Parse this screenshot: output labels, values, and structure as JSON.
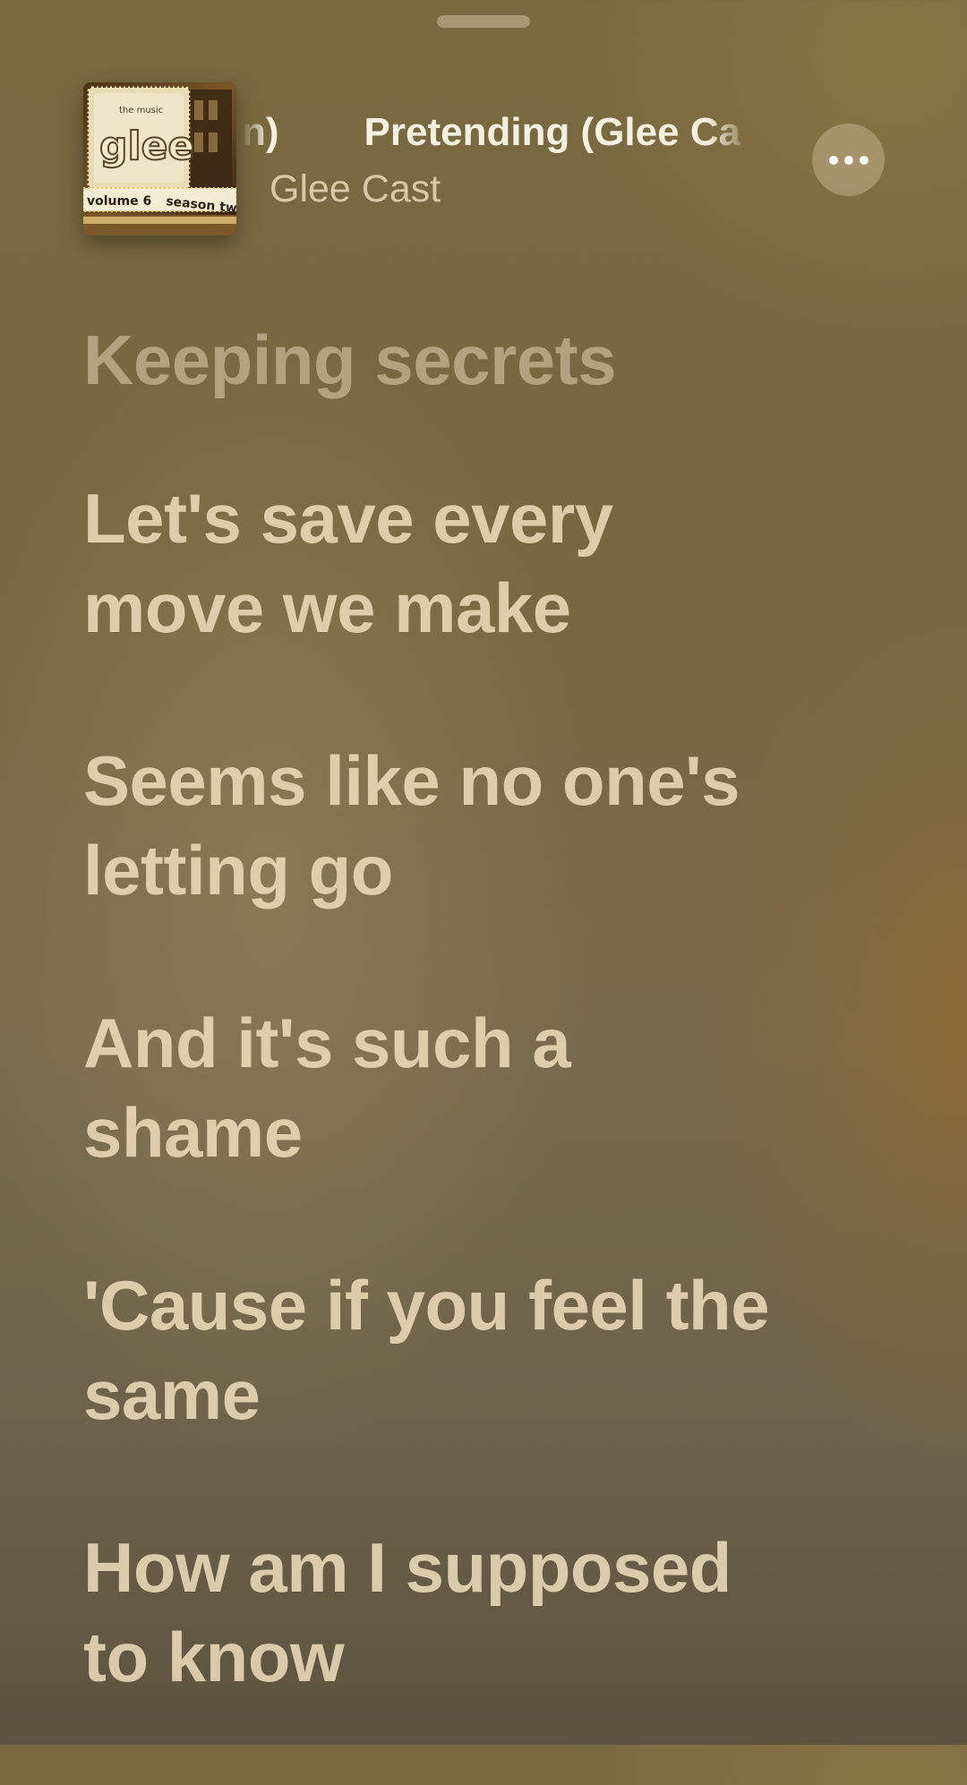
{
  "sheet": {
    "grabber": "drag-handle"
  },
  "now_playing": {
    "title": "Pretending (Glee Cast Version)",
    "title_visible_prefix_fragment": "n)",
    "title_visible_main": "Pretending (Glee Ca",
    "artist": "Glee Cast",
    "album_art_text": {
      "line1": "the music",
      "logo": "glee",
      "volume": "volume 6",
      "season": "season two"
    },
    "more_icon": "ellipsis-icon"
  },
  "lyrics": {
    "lines": [
      "Keeping secrets",
      "Let's save every move we make",
      "Seems like no one's letting go",
      "And it's such a shame",
      "'Cause if you feel the same",
      "How am I supposed to know"
    ],
    "rendered": {
      "l0": "Keeping secrets",
      "l1a": "Let's save every",
      "l1b": "move we make",
      "l2a": "Seems like no one's",
      "l2b": "letting go",
      "l3a": "And it's such a",
      "l3b": "shame",
      "l4a": "'Cause if you feel the",
      "l4b": "same",
      "l5a": "How am I supposed",
      "l5b": "to know"
    }
  },
  "colors": {
    "background_top": "#78693f",
    "background_bottom": "#5c5340",
    "lyric_text": "#eadbb8",
    "title_text": "#f6f0e1"
  }
}
